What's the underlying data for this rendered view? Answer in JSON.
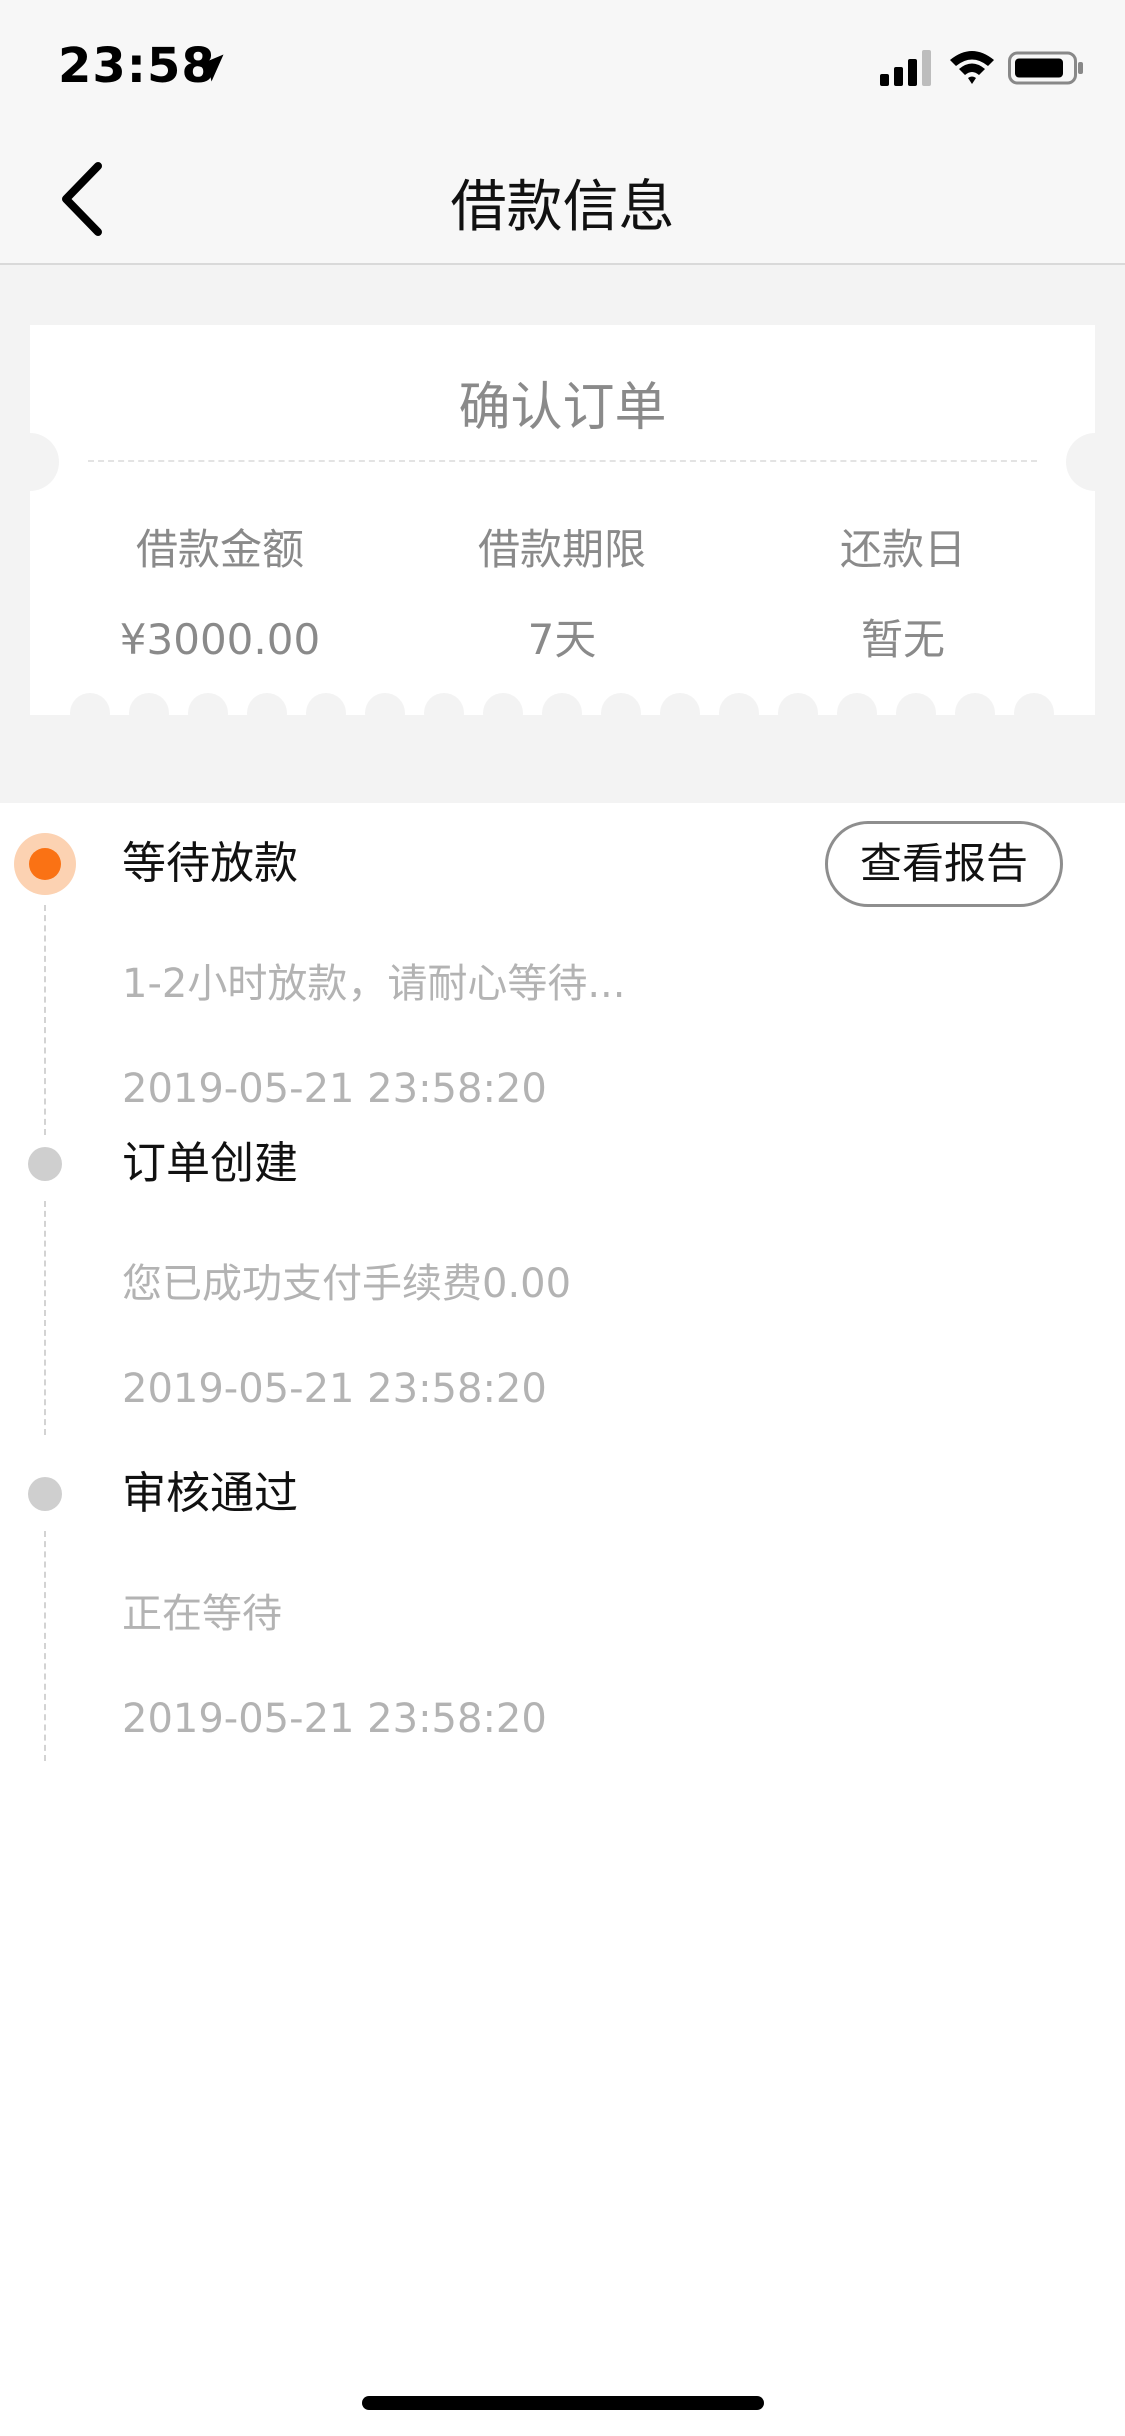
{
  "status_bar": {
    "time": "23:58",
    "icons": [
      "location-arrow-icon",
      "signal-icon",
      "wifi-icon",
      "battery-icon"
    ]
  },
  "nav": {
    "back_icon": "chevron-left-icon",
    "title": "借款信息"
  },
  "order_card": {
    "title": "确认订单",
    "columns": [
      {
        "label": "借款金额",
        "value": "¥3000.00"
      },
      {
        "label": "借款期限",
        "value": "7天"
      },
      {
        "label": "还款日",
        "value": "暂无"
      }
    ]
  },
  "timeline": {
    "steps": [
      {
        "title": "等待放款",
        "description": "1-2小时放款，请耐心等待...",
        "time": "2019-05-21 23:58:20",
        "active": true
      },
      {
        "title": "订单创建",
        "description": "您已成功支付手续费0.00",
        "time": "2019-05-21 23:58:20",
        "active": false
      },
      {
        "title": "审核通过",
        "description": "正在等待",
        "time": "2019-05-21 23:58:20",
        "active": false
      }
    ],
    "report_button_label": "查看报告"
  },
  "colors": {
    "accent": "#fa7214",
    "accent_ring": "#fcd2b2",
    "inactive_dot": "#cfcfcf",
    "muted_text": "#b3b3b3",
    "card_text": "#8a8a8a",
    "background_band": "#f3f3f3"
  }
}
